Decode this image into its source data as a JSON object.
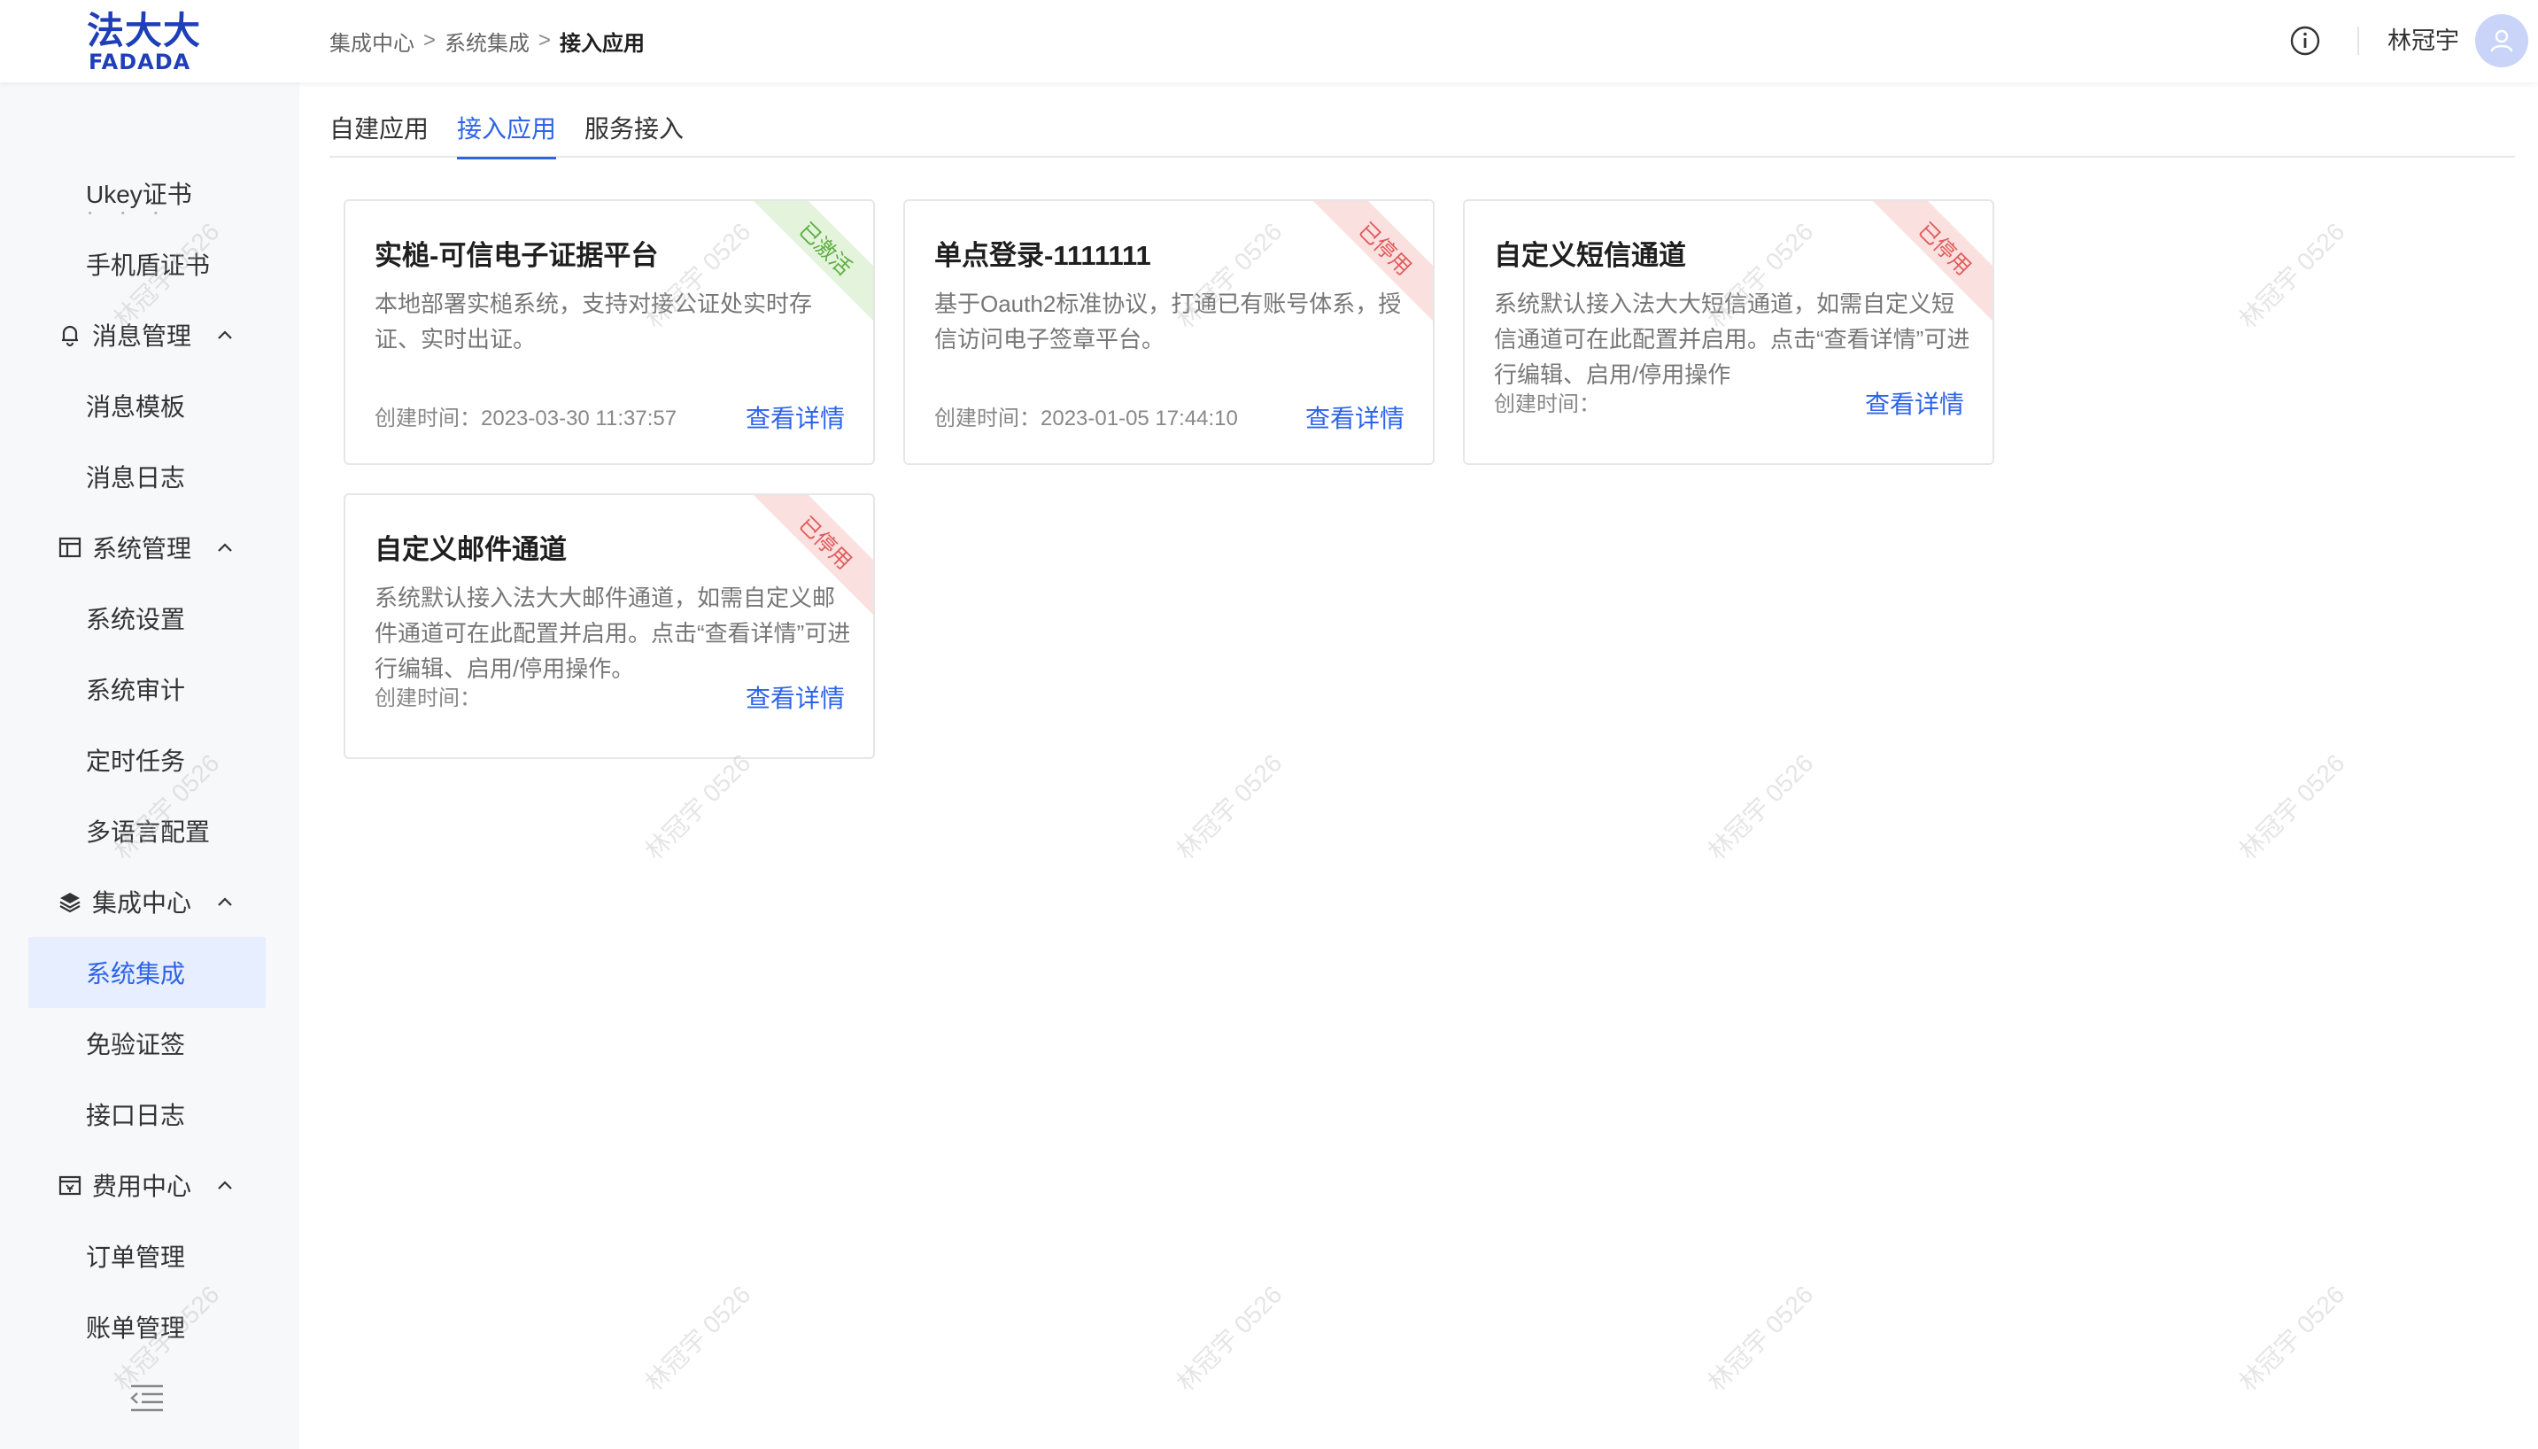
{
  "header": {
    "logo_cn": "法大大",
    "logo_en": "FADADA",
    "breadcrumb": [
      "集成中心",
      "系统集成",
      "接入应用"
    ],
    "breadcrumb_sep": ">",
    "info_icon": "info-circle-icon",
    "username": "林冠宇",
    "avatar_icon": "user-icon"
  },
  "sidebar": {
    "faded_item": "·   ·  ·",
    "items": [
      {
        "label": "Ukey证书",
        "type": "item"
      },
      {
        "label": "手机盾证书",
        "type": "item"
      },
      {
        "label": "消息管理",
        "type": "group",
        "icon": "bell-icon"
      },
      {
        "label": "消息模板",
        "type": "item"
      },
      {
        "label": "消息日志",
        "type": "item"
      },
      {
        "label": "系统管理",
        "type": "group",
        "icon": "layout-icon"
      },
      {
        "label": "系统设置",
        "type": "item"
      },
      {
        "label": "系统审计",
        "type": "item"
      },
      {
        "label": "定时任务",
        "type": "item"
      },
      {
        "label": "多语言配置",
        "type": "item"
      },
      {
        "label": "集成中心",
        "type": "group",
        "icon": "layers-icon"
      },
      {
        "label": "系统集成",
        "type": "item",
        "active": true
      },
      {
        "label": "免验证签",
        "type": "item"
      },
      {
        "label": "接口日志",
        "type": "item"
      },
      {
        "label": "费用中心",
        "type": "group",
        "icon": "billing-icon"
      },
      {
        "label": "订单管理",
        "type": "item"
      },
      {
        "label": "账单管理",
        "type": "item"
      }
    ],
    "collapse_icon": "menu-fold-icon"
  },
  "tabs": [
    {
      "label": "自建应用",
      "active": false
    },
    {
      "label": "接入应用",
      "active": true
    },
    {
      "label": "服务接入",
      "active": false
    }
  ],
  "cards": [
    {
      "title": "实槌-可信电子证据平台",
      "desc": "本地部署实槌系统，支持对接公证处实时存证、实时出证。",
      "time": "创建时间：2023-03-30 11:37:57",
      "link": "查看详情",
      "status": "已激活",
      "status_color": "#5cae3e"
    },
    {
      "title": "单点登录-1111111",
      "desc": "基于Oauth2标准协议，打通已有账号体系，授信访问电子签章平台。",
      "time": "创建时间：2023-01-05 17:44:10",
      "link": "查看详情",
      "status": "已停用",
      "status_color": "#e05a5a"
    },
    {
      "title": "自定义短信通道",
      "desc": "系统默认接入法大大短信通道，如需自定义短信通道可在此配置并启用。点击“查看详情”可进行编辑、启用/停用操作",
      "time": "创建时间：",
      "link": "查看详情",
      "status": "已停用",
      "status_color": "#e05a5a"
    },
    {
      "title": "自定义邮件通道",
      "desc": "系统默认接入法大大邮件通道，如需自定义邮件通道可在此配置并启用。点击“查看详情”可进行编辑、启用/停用操作。",
      "time": "创建时间：",
      "link": "查看详情",
      "status": "已停用",
      "status_color": "#e05a5a"
    }
  ],
  "watermark": "林冠宇 0526",
  "colors": {
    "accent": "#2f64e8",
    "brand": "#1f3fb8",
    "sidebar_bg": "#f7f8fa",
    "active_bg": "#e6eeff"
  }
}
